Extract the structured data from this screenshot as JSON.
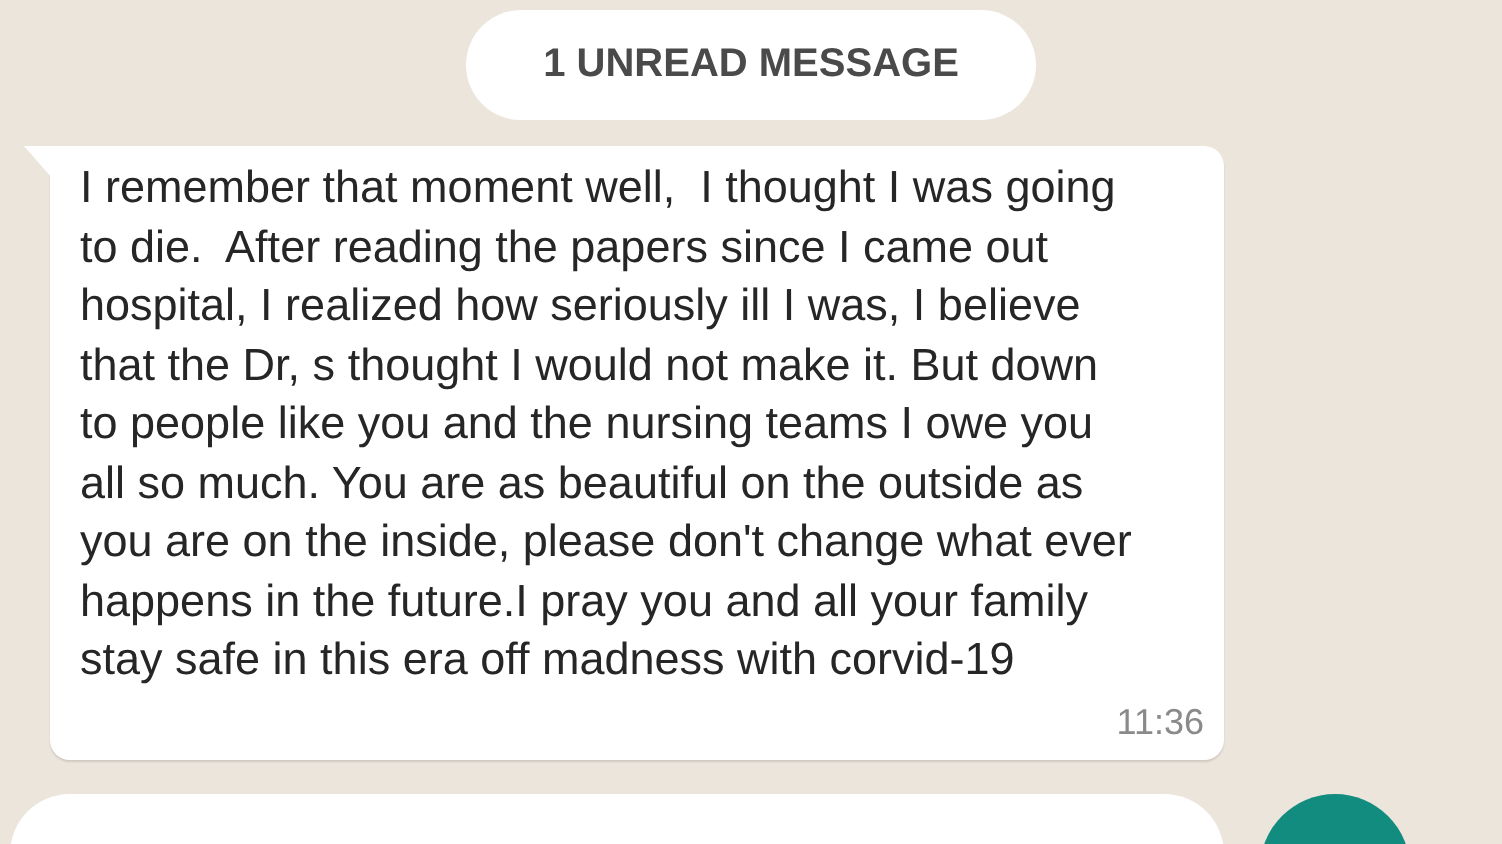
{
  "unread_banner": {
    "label": "1 UNREAD MESSAGE"
  },
  "message": {
    "lines": [
      "I remember that moment well,  I thought I was going",
      "to die.  After reading the papers since I came out",
      "hospital, I realized how seriously ill I was, I believe",
      "that the Dr, s thought I would not make it. But down",
      "to people like you and the nursing teams I owe you",
      "all so much. You are as beautiful on the outside as",
      "you are on the inside, please don't change what ever",
      "happens in the future.I pray you and all your family",
      "stay safe in this era off madness with corvid-19"
    ],
    "time": "11:36"
  }
}
